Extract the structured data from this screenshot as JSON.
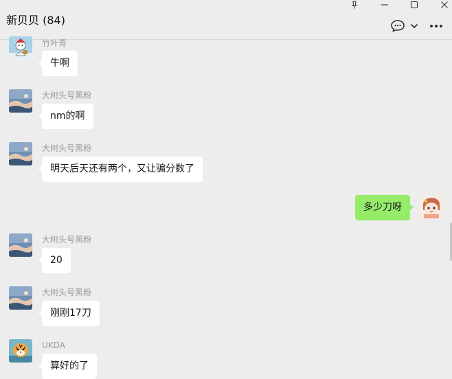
{
  "window": {
    "pin_icon": "pin-icon",
    "minimize_icon": "minimize-icon",
    "maximize_icon": "maximize-icon",
    "close_icon": "close-icon"
  },
  "header": {
    "title": "新贝贝 (84)",
    "chat_icon": "chat-bubble-icon",
    "dropdown_icon": "chevron-down-icon",
    "more_icon": "more-icon"
  },
  "colors": {
    "background": "#ededed",
    "bubble_incoming": "#ffffff",
    "bubble_outgoing": "#95ec69",
    "sender_name": "#9b9b9b"
  },
  "messages": [
    {
      "sender": "竹叶青",
      "text": "牛啊",
      "self": false,
      "avatar": "cartoon-figure"
    },
    {
      "sender": "大树头号黑粉",
      "text": "nm的啊",
      "self": false,
      "avatar": "sky-landscape"
    },
    {
      "sender": "大树头号黑粉",
      "text": "明天后天还有两个，又让骗分数了",
      "self": false,
      "avatar": "sky-landscape"
    },
    {
      "sender": "",
      "text": "多少刀呀",
      "self": true,
      "avatar": "cartoon-girl"
    },
    {
      "sender": "大树头号黑粉",
      "text": "20",
      "self": false,
      "avatar": "sky-landscape"
    },
    {
      "sender": "大树头号黑粉",
      "text": "刚刚17刀",
      "self": false,
      "avatar": "sky-landscape"
    },
    {
      "sender": "UKDA",
      "text": "算好的了",
      "self": false,
      "avatar": "tiger-cartoon"
    }
  ]
}
